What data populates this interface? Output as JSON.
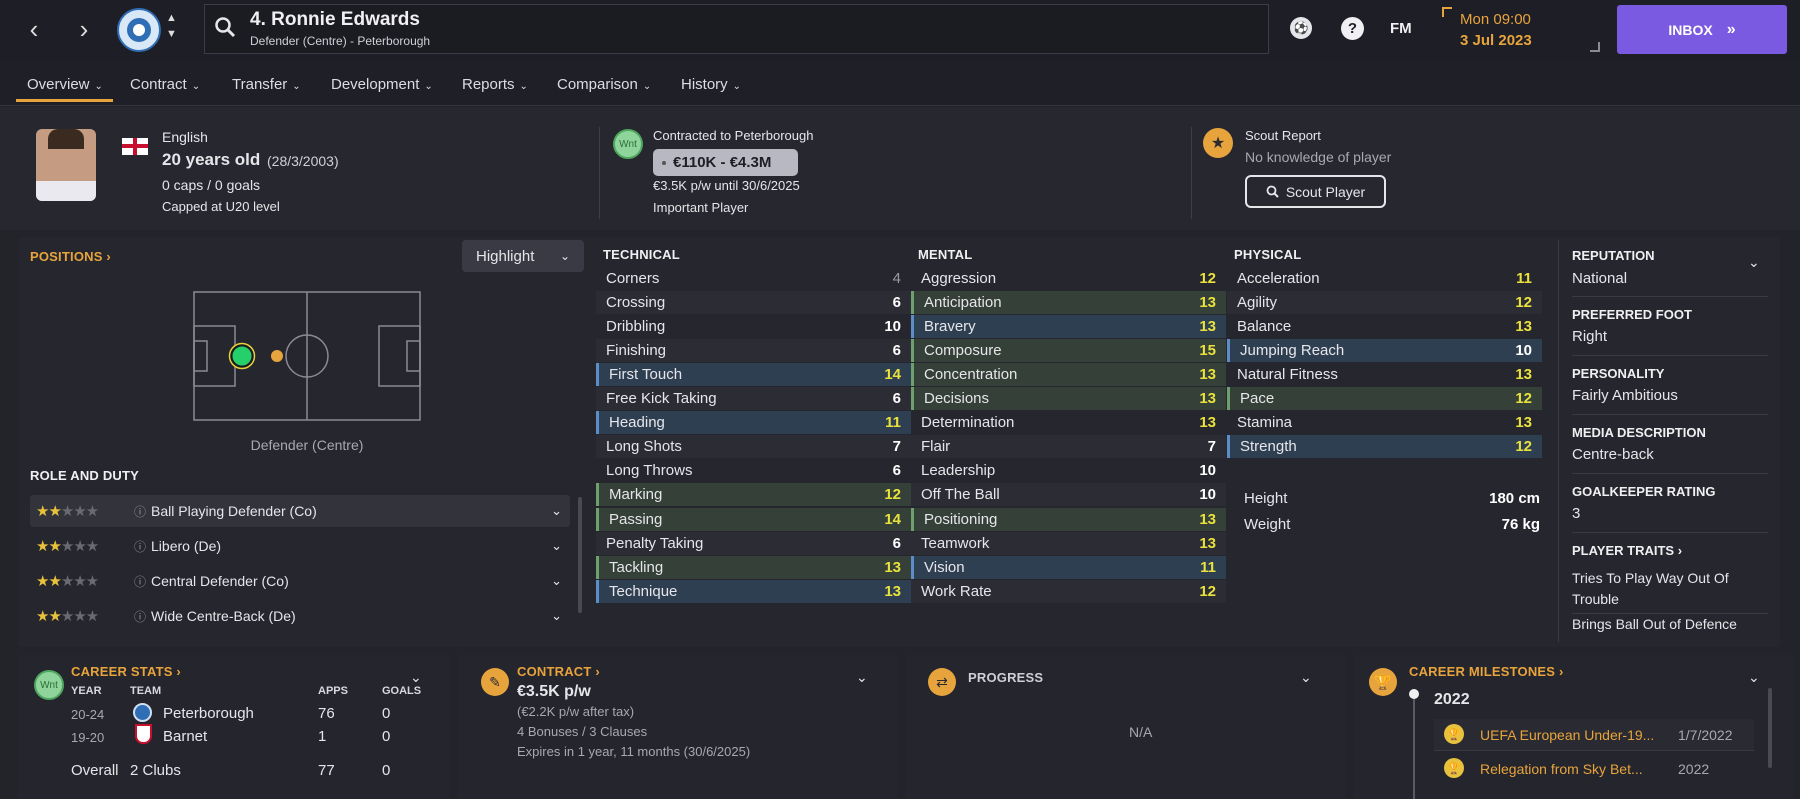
{
  "topbar": {
    "player_name": "4. Ronnie Edwards",
    "player_subtitle": "Defender (Centre) - Peterborough",
    "fm_label": "FM",
    "help_label": "?",
    "date_day": "Mon 09:00",
    "date_full": "3 Jul 2023",
    "inbox_label": "INBOX",
    "accent": "#7a5ae0"
  },
  "tabs": [
    {
      "label": "Overview"
    },
    {
      "label": "Contract"
    },
    {
      "label": "Transfer"
    },
    {
      "label": "Development"
    },
    {
      "label": "Reports"
    },
    {
      "label": "Comparison"
    },
    {
      "label": "History"
    }
  ],
  "profile": {
    "nationality": "English",
    "age": "20 years old",
    "dob": "(28/3/2003)",
    "caps": "0 caps / 0 goals",
    "capped_level": "Capped at U20 level"
  },
  "contract_summary": {
    "badge": "Wnt",
    "contracted_to": "Contracted to Peterborough",
    "value": "€110K - €4.3M",
    "wage": "€3.5K p/w until 30/6/2025",
    "status": "Important Player"
  },
  "scout": {
    "title": "Scout Report",
    "knowledge": "No knowledge of player",
    "button": "Scout Player"
  },
  "positions": {
    "heading": "POSITIONS",
    "highlight": "Highlight",
    "position_label": "Defender (Centre)",
    "role_heading": "ROLE AND DUTY",
    "roles": [
      {
        "name": "Ball Playing Defender (Co)",
        "stars": 2
      },
      {
        "name": "Libero (De)",
        "stars": 2
      },
      {
        "name": "Central Defender (Co)",
        "stars": 2
      },
      {
        "name": "Wide Centre-Back (De)",
        "stars": 2
      }
    ]
  },
  "attributes": {
    "technical": {
      "heading": "TECHNICAL",
      "items": [
        {
          "n": "Corners",
          "v": "4"
        },
        {
          "n": "Crossing",
          "v": "6"
        },
        {
          "n": "Dribbling",
          "v": "10"
        },
        {
          "n": "Finishing",
          "v": "6"
        },
        {
          "n": "First Touch",
          "v": "14"
        },
        {
          "n": "Free Kick Taking",
          "v": "6"
        },
        {
          "n": "Heading",
          "v": "11"
        },
        {
          "n": "Long Shots",
          "v": "7"
        },
        {
          "n": "Long Throws",
          "v": "6"
        },
        {
          "n": "Marking",
          "v": "12"
        },
        {
          "n": "Passing",
          "v": "14"
        },
        {
          "n": "Penalty Taking",
          "v": "6"
        },
        {
          "n": "Tackling",
          "v": "13"
        },
        {
          "n": "Technique",
          "v": "13"
        }
      ]
    },
    "mental": {
      "heading": "MENTAL",
      "items": [
        {
          "n": "Aggression",
          "v": "12"
        },
        {
          "n": "Anticipation",
          "v": "13"
        },
        {
          "n": "Bravery",
          "v": "13"
        },
        {
          "n": "Composure",
          "v": "15"
        },
        {
          "n": "Concentration",
          "v": "13"
        },
        {
          "n": "Decisions",
          "v": "13"
        },
        {
          "n": "Determination",
          "v": "13"
        },
        {
          "n": "Flair",
          "v": "7"
        },
        {
          "n": "Leadership",
          "v": "10"
        },
        {
          "n": "Off The Ball",
          "v": "10"
        },
        {
          "n": "Positioning",
          "v": "13"
        },
        {
          "n": "Teamwork",
          "v": "13"
        },
        {
          "n": "Vision",
          "v": "11"
        },
        {
          "n": "Work Rate",
          "v": "12"
        }
      ]
    },
    "physical": {
      "heading": "PHYSICAL",
      "items": [
        {
          "n": "Acceleration",
          "v": "11"
        },
        {
          "n": "Agility",
          "v": "12"
        },
        {
          "n": "Balance",
          "v": "13"
        },
        {
          "n": "Jumping Reach",
          "v": "10"
        },
        {
          "n": "Natural Fitness",
          "v": "13"
        },
        {
          "n": "Pace",
          "v": "12"
        },
        {
          "n": "Stamina",
          "v": "13"
        },
        {
          "n": "Strength",
          "v": "12"
        }
      ]
    },
    "height_label": "Height",
    "height": "180 cm",
    "weight_label": "Weight",
    "weight": "76 kg"
  },
  "info": {
    "reputation_label": "REPUTATION",
    "reputation": "National",
    "foot_label": "PREFERRED FOOT",
    "foot": "Right",
    "personality_label": "PERSONALITY",
    "personality": "Fairly Ambitious",
    "media_label": "MEDIA DESCRIPTION",
    "media": "Centre-back",
    "gk_label": "GOALKEEPER RATING",
    "gk": "3",
    "traits_label": "PLAYER TRAITS",
    "trait1": "Tries To Play Way Out Of Trouble",
    "trait2": "Brings Ball Out of Defence"
  },
  "career": {
    "badge": "Wnt",
    "heading": "CAREER STATS",
    "cols": {
      "year": "YEAR",
      "team": "TEAM",
      "apps": "APPS",
      "goals": "GOALS"
    },
    "rows": [
      {
        "year": "20-24",
        "team": "Peterborough",
        "apps": "76",
        "goals": "0"
      },
      {
        "year": "19-20",
        "team": "Barnet",
        "apps": "1",
        "goals": "0"
      }
    ],
    "overall_label": "Overall",
    "overall_team": "2 Clubs",
    "overall_apps": "77",
    "overall_goals": "0"
  },
  "contract": {
    "heading": "CONTRACT",
    "wage": "€3.5K p/w",
    "after_tax": "(€2.2K p/w after tax)",
    "bonuses": "4 Bonuses / 3 Clauses",
    "expires": "Expires in 1 year, 11 months (30/6/2025)"
  },
  "progress": {
    "heading": "PROGRESS",
    "value": "N/A"
  },
  "milestones": {
    "heading": "CAREER MILESTONES",
    "year": "2022",
    "items": [
      {
        "text": "UEFA European Under-19...",
        "date": "1/7/2022"
      },
      {
        "text": "Relegation from Sky Bet...",
        "date": "2022"
      }
    ]
  }
}
